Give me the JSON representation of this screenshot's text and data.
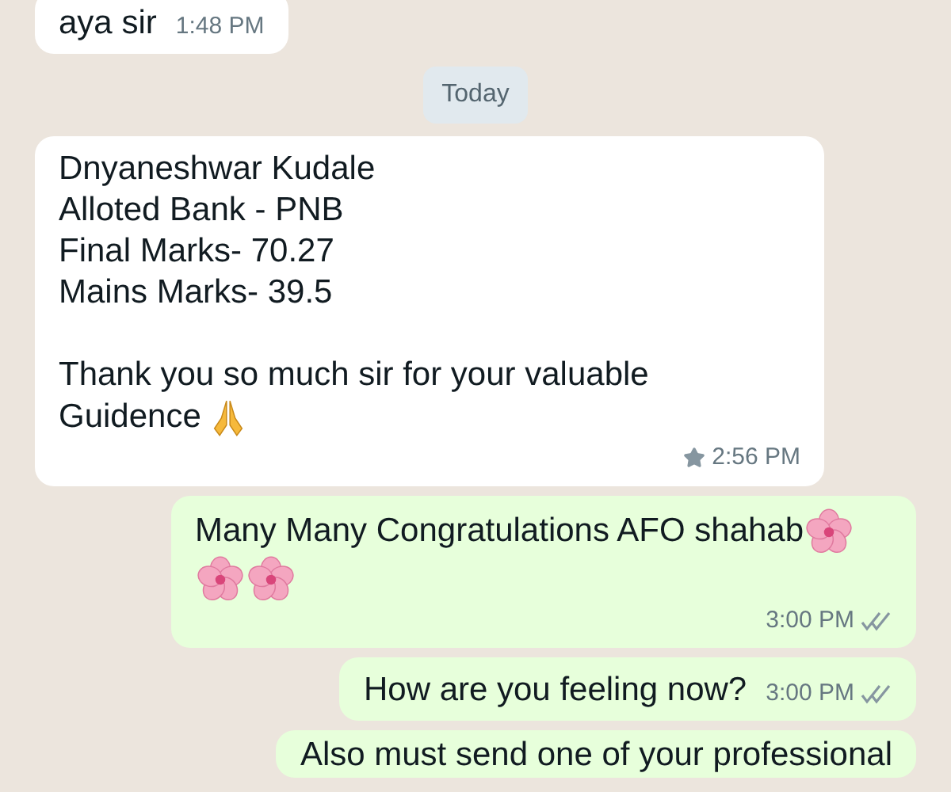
{
  "messages": [
    {
      "kind": "incoming",
      "text": "aya sir",
      "time": "1:48 PM",
      "starred": false
    },
    {
      "kind": "date",
      "text": "Today"
    },
    {
      "kind": "incoming",
      "text": "Dnyaneshwar Kudale\nAlloted Bank - PNB\nFinal Marks- 70.27\nMains Marks- 39.5\n\nThank you so much sir for your valuable Guidence",
      "emojis": [
        {
          "kind": "pray"
        }
      ],
      "time": "2:56 PM",
      "starred": true
    },
    {
      "kind": "outgoing",
      "text": "Many Many Congratulations AFO shahab",
      "emojis": [
        {
          "kind": "blossom"
        },
        {
          "kind": "blossom"
        },
        {
          "kind": "blossom"
        }
      ],
      "time": "3:00 PM",
      "delivered": true
    },
    {
      "kind": "outgoing",
      "text": "How are you feeling now?",
      "time": "3:00 PM",
      "delivered": true
    },
    {
      "kind": "outgoing",
      "text": "Also must send one of your professional"
    }
  ]
}
